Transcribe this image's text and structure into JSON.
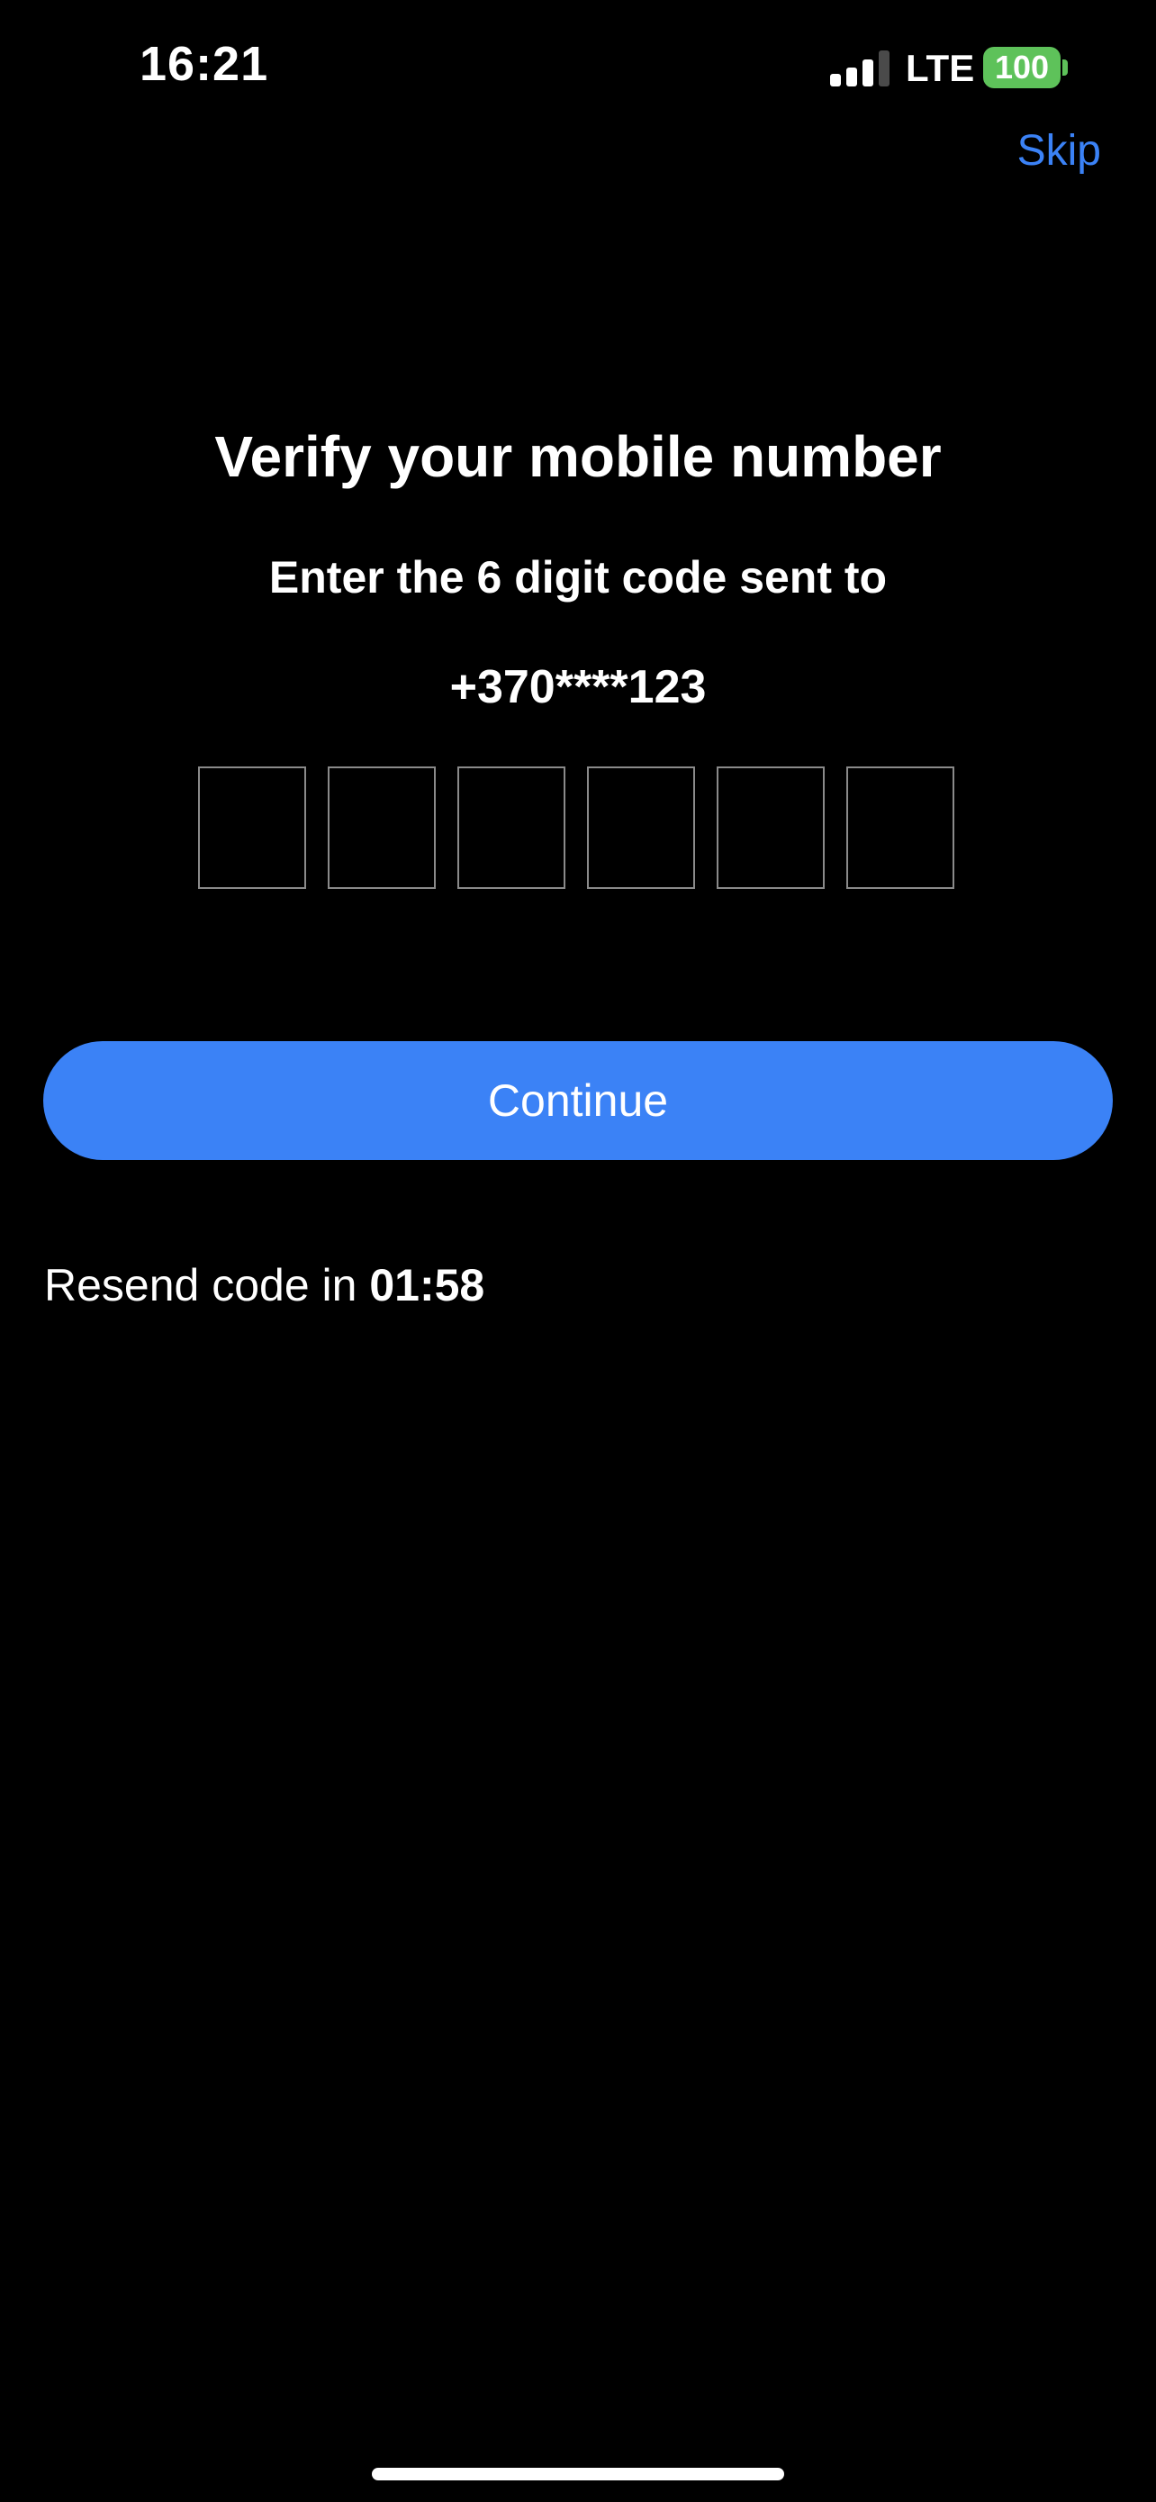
{
  "status_bar": {
    "time": "16:21",
    "network": "LTE",
    "battery": "100",
    "signal_icon": "cellular-signal-icon",
    "signal_bars_active": 3,
    "signal_bars_total": 4,
    "battery_color": "#5ec25a"
  },
  "header": {
    "skip_label": "Skip"
  },
  "main": {
    "title": "Verify your mobile number",
    "subtitle": "Enter the 6 digit code sent to",
    "phone_number": "+370****123",
    "code_inputs": [
      "",
      "",
      "",
      "",
      "",
      ""
    ],
    "continue_label": "Continue",
    "resend_prefix": "Resend code in ",
    "resend_timer": "01:58"
  },
  "colors": {
    "accent": "#3b82f6",
    "background": "#000000",
    "text": "#ffffff",
    "input_border": "#8a8a8a"
  }
}
